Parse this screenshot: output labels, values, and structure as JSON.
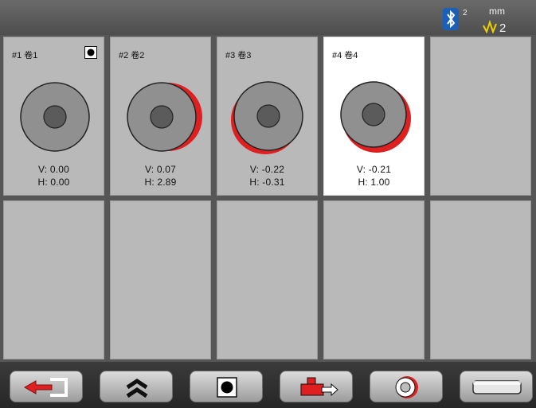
{
  "status": {
    "bluetooth_count": "2",
    "unit_top": "mm",
    "unit_bottom_value": "2"
  },
  "cells": [
    {
      "label": "#1 卷1",
      "v": "V: 0.00",
      "h": "H: 0.00",
      "active": false,
      "has_indicator": true
    },
    {
      "label": "#2 卷2",
      "v": "V: 0.07",
      "h": "H: 2.89",
      "active": false,
      "has_indicator": false
    },
    {
      "label": "#3 卷3",
      "v": "V: -0.22",
      "h": "H: -0.31",
      "active": false,
      "has_indicator": false
    },
    {
      "label": "#4 卷4",
      "v": "V: -0.21",
      "h": "H: 1.00",
      "active": true,
      "has_indicator": false
    }
  ],
  "colors": {
    "accent_red": "#e02020",
    "disc_fill": "#8e8e8e",
    "hub_fill": "#5a5a5a"
  },
  "toolbar": {
    "icons": [
      "exit-icon",
      "chevrons-up-icon",
      "record-square-icon",
      "transfer-icon",
      "target-disc-icon",
      "cylinder-icon"
    ]
  }
}
